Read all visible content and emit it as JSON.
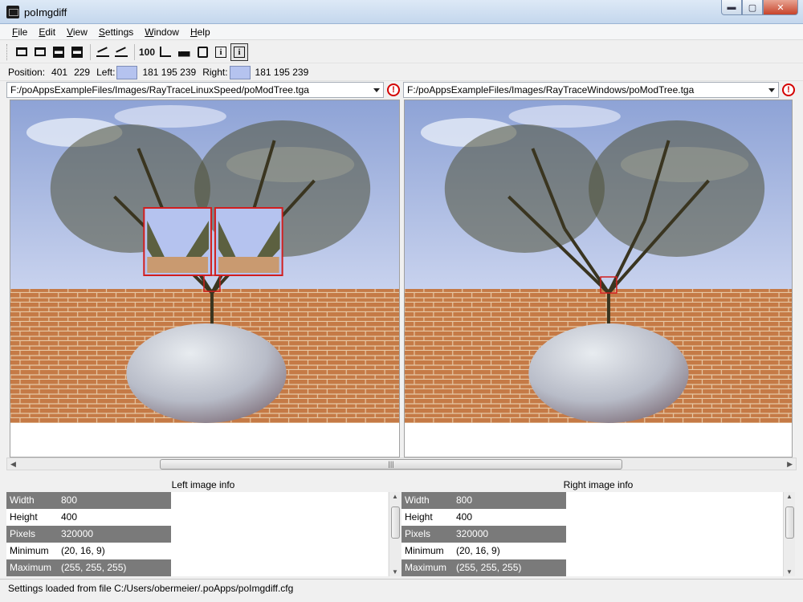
{
  "window": {
    "title": "poImgdiff",
    "controls": {
      "minimize": "▬",
      "maximize": "▢",
      "close": "✕"
    }
  },
  "menu": [
    {
      "key": "F",
      "rest": "ile"
    },
    {
      "key": "E",
      "rest": "dit"
    },
    {
      "key": "V",
      "rest": "iew"
    },
    {
      "key": "S",
      "rest": "ettings"
    },
    {
      "key": "W",
      "rest": "indow"
    },
    {
      "key": "H",
      "rest": "elp"
    }
  ],
  "toolbar": {
    "zoom100_label": "100",
    "icons": [
      "open-left-icon",
      "open-right-icon",
      "save-left-icon",
      "save-right-icon",
      "diff-icon",
      "diff-alt-icon",
      "zoom-100-icon",
      "graph-icon",
      "histogram-icon",
      "find-icon",
      "info-icon",
      "info-active-icon"
    ]
  },
  "position": {
    "label": "Position:",
    "x": "401",
    "y": "229",
    "left_label": "Left:",
    "left_rgb": "181 195 239",
    "right_label": "Right:",
    "right_rgb": "181 195 239",
    "swatch_color": "#b5c3ef"
  },
  "files": {
    "left_path": "F:/poAppsExampleFiles/Images/RayTraceLinuxSpeed/poModTree.tga",
    "right_path": "F:/poAppsExampleFiles/Images/RayTraceWindows/poModTree.tga",
    "warning_glyph": "!"
  },
  "scrollbar": {
    "grip": "|||",
    "left_arrow": "◀",
    "right_arrow": "▶"
  },
  "left_info": {
    "title": "Left image info",
    "rows": [
      {
        "key": "Width",
        "value": "800"
      },
      {
        "key": "Height",
        "value": "400"
      },
      {
        "key": "Pixels",
        "value": "320000"
      },
      {
        "key": "Minimum",
        "value": "(20, 16, 9)"
      },
      {
        "key": "Maximum",
        "value": "(255, 255, 255)"
      }
    ]
  },
  "right_info": {
    "title": "Right image info",
    "rows": [
      {
        "key": "Width",
        "value": "800"
      },
      {
        "key": "Height",
        "value": "400"
      },
      {
        "key": "Pixels",
        "value": "320000"
      },
      {
        "key": "Minimum",
        "value": "(20, 16, 9)"
      },
      {
        "key": "Maximum",
        "value": "(255, 255, 255)"
      }
    ]
  },
  "status": {
    "message": "Settings loaded from file C:/Users/obermeier/.poApps/poImgdiff.cfg"
  },
  "colors": {
    "highlight_red": "#d21e1e",
    "sky": "#b5c3ef",
    "brick": "#c7804d"
  }
}
